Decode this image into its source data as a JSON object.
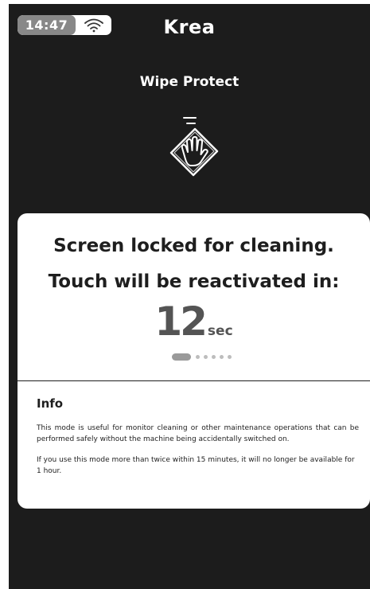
{
  "status_bar": {
    "time": "14:47",
    "wifi_icon": "wifi-icon"
  },
  "header": {
    "logo_text": "Krea"
  },
  "page": {
    "title": "Wipe Protect",
    "icon": "wipe-cleaning-icon"
  },
  "lock_card": {
    "line1": "Screen locked for cleaning.",
    "line2": "Touch will be reactivated in:",
    "countdown_value": "12",
    "countdown_unit": "sec",
    "pager": {
      "active_index": 0,
      "total": 6
    }
  },
  "info": {
    "heading": "Info",
    "paragraph1": "This mode is useful for monitor cleaning or other maintenance operations that can be performed safely without the machine being accidentally switched on.",
    "paragraph2": "If you use this mode more than twice within 15 minutes, it will no longer be available for 1 hour."
  },
  "colors": {
    "screen_background": "#1c1c1c",
    "card_background": "#ffffff",
    "countdown_text": "#545454",
    "time_badge": "#888888"
  }
}
